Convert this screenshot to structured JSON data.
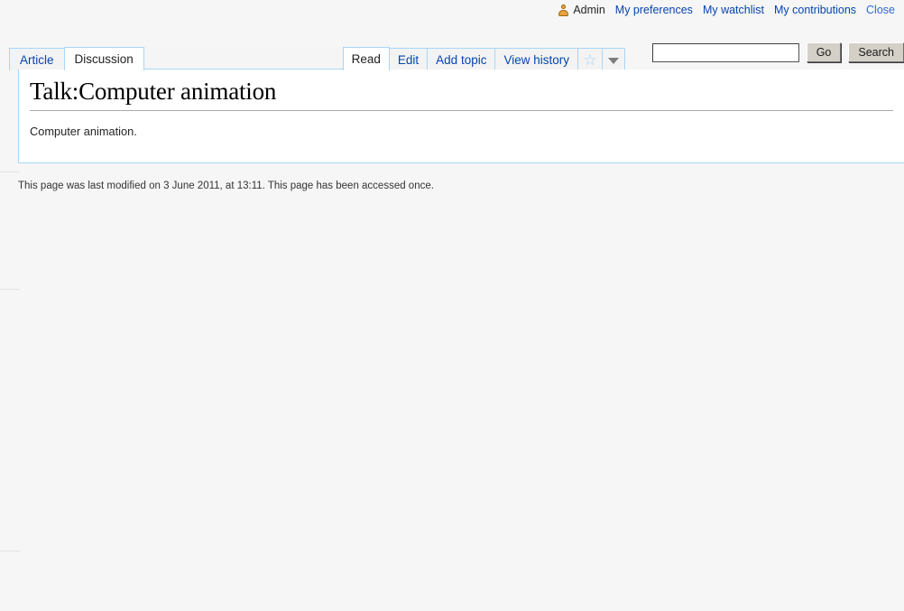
{
  "personal_bar": {
    "user_icon": "user-avatar-icon",
    "username": "Admin",
    "links": [
      {
        "label": "My preferences"
      },
      {
        "label": "My watchlist"
      },
      {
        "label": "My contributions"
      }
    ],
    "close_label": "Close"
  },
  "namespace_tabs": [
    {
      "label": "Article",
      "selected": false
    },
    {
      "label": "Discussion",
      "selected": true
    }
  ],
  "action_tabs": [
    {
      "label": "Read",
      "selected": true
    },
    {
      "label": "Edit",
      "selected": false
    },
    {
      "label": "Add topic",
      "selected": false
    },
    {
      "label": "View history",
      "selected": false
    }
  ],
  "watch_star_icon": "star-outline-icon",
  "actions_chevron_icon": "chevron-down-icon",
  "search": {
    "value": "",
    "placeholder": "",
    "go_label": "Go",
    "search_label": "Search"
  },
  "page": {
    "title": "Talk:Computer animation",
    "body_text": "Computer animation."
  },
  "footer": {
    "text": "This page was last modified on 3 June 2011, at 13:11. This page has been accessed once."
  },
  "colors": {
    "link": "#0645ad",
    "tab_border": "#a7d7f9",
    "page_background": "#f6f6f6",
    "content_background": "#ffffff",
    "button_face": "#d4d0c8",
    "user_icon": "#e8a33d"
  }
}
